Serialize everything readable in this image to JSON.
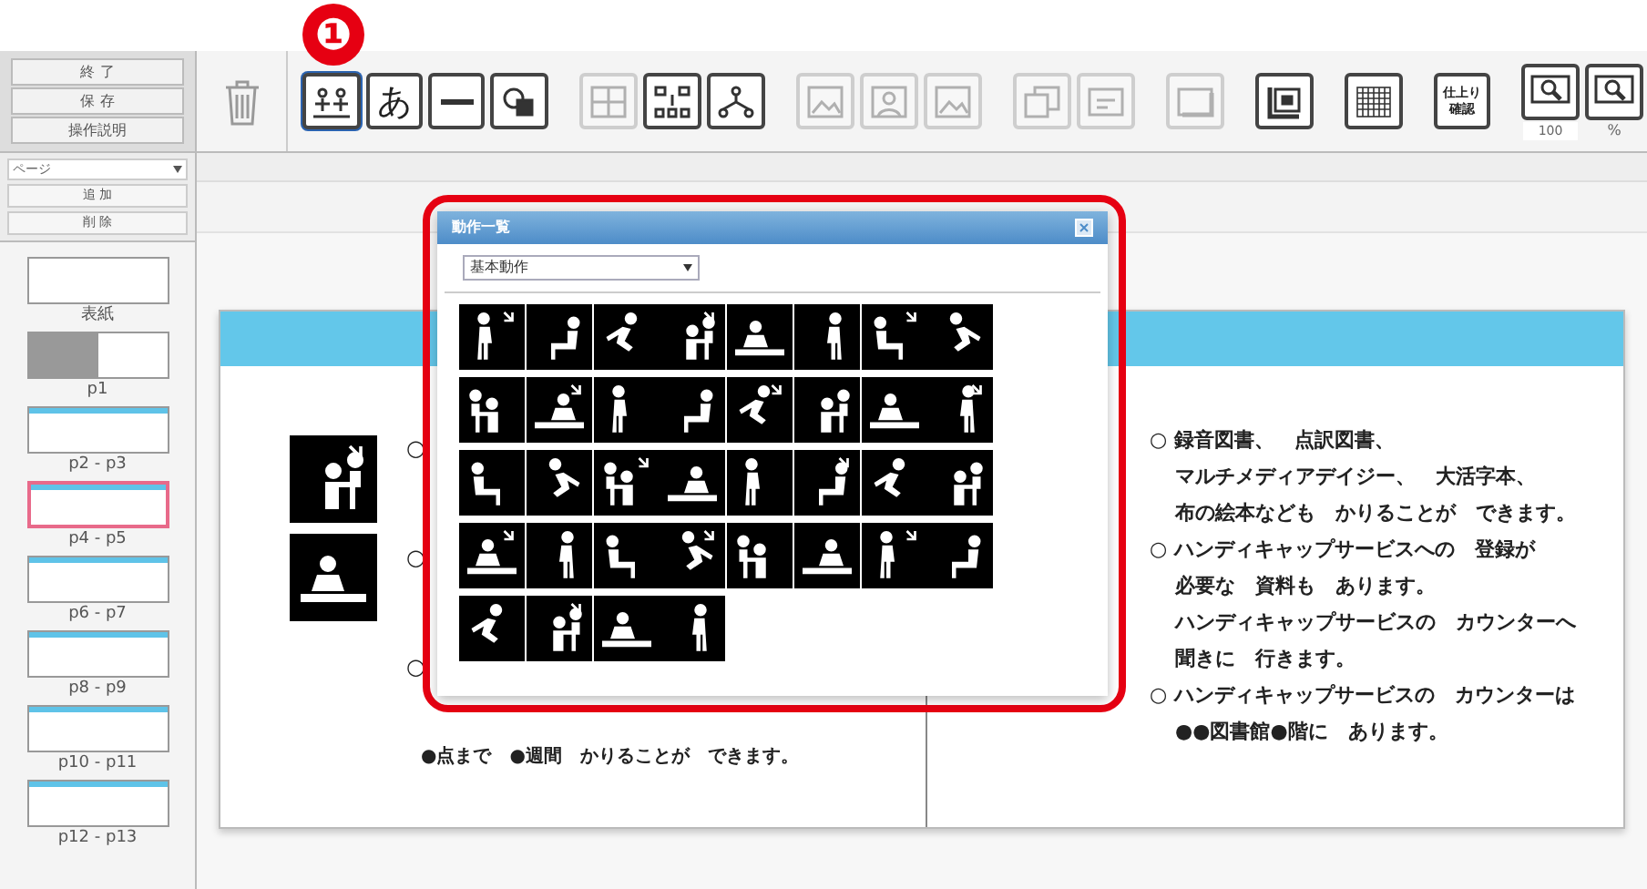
{
  "badge": "❶",
  "file_buttons": [
    "終 了",
    "保 存",
    "操作説明"
  ],
  "toolbar": [
    {
      "kind": "pictogram",
      "selected": true,
      "disabled": false
    },
    {
      "kind": "text",
      "label": "あ",
      "selected": false,
      "disabled": false
    },
    {
      "kind": "line",
      "selected": false,
      "disabled": false
    },
    {
      "kind": "shapes",
      "selected": false,
      "disabled": false
    },
    {
      "kind": "layout",
      "selected": false,
      "disabled": true
    },
    {
      "kind": "flow",
      "selected": false,
      "disabled": false
    },
    {
      "kind": "tree",
      "selected": false,
      "disabled": false
    },
    {
      "kind": "image",
      "selected": false,
      "disabled": true
    },
    {
      "kind": "person",
      "selected": false,
      "disabled": true
    },
    {
      "kind": "image",
      "selected": false,
      "disabled": true
    },
    {
      "kind": "copy",
      "selected": false,
      "disabled": true
    },
    {
      "kind": "paste",
      "selected": false,
      "disabled": true
    },
    {
      "kind": "frame",
      "selected": false,
      "disabled": true
    },
    {
      "kind": "book",
      "selected": false,
      "disabled": false
    },
    {
      "kind": "grid",
      "selected": false,
      "disabled": false
    },
    {
      "kind": "text",
      "label": "仕上り確認",
      "selected": false,
      "disabled": false
    },
    {
      "kind": "zoom",
      "selected": false,
      "disabled": false
    },
    {
      "kind": "zoom",
      "selected": false,
      "disabled": false
    }
  ],
  "zoom": {
    "value": "100",
    "unit": "%"
  },
  "page_select": "ページ",
  "page_buttons": [
    "追 加",
    "削 除"
  ],
  "thumbnails": [
    {
      "label": "表紙",
      "selected": false
    },
    {
      "label": "p1",
      "selected": false
    },
    {
      "label": "p2 - p3",
      "selected": false
    },
    {
      "label": "p4 - p5",
      "selected": true
    },
    {
      "label": "p6 - p7",
      "selected": false
    },
    {
      "label": "p8 - p9",
      "selected": false
    },
    {
      "label": "p10 - p11",
      "selected": false
    },
    {
      "label": "p12 - p13",
      "selected": false
    }
  ],
  "dialog": {
    "title": "動作一覧",
    "category": "基本動作"
  },
  "left_page": {
    "bullets": [
      "○",
      "○",
      "○"
    ],
    "last_line": "●点まで　●週間　かりることが　できます。"
  },
  "right_page": {
    "lines": [
      {
        "text": "○ 録音図書、　点訳図書、",
        "indent": false
      },
      {
        "text": "マルチメディアデイジー、　大活字本、",
        "indent": true
      },
      {
        "text": "布の絵本なども　かりることが　できます。",
        "indent": true
      },
      {
        "text": "○ ハンディキャップサービスへの　登録が",
        "indent": false
      },
      {
        "text": "必要な　資料も　あります。",
        "indent": true
      },
      {
        "text": "ハンディキャップサービスの　カウンターへ",
        "indent": true
      },
      {
        "text": "聞きに　行きます。",
        "indent": true
      },
      {
        "text": "○ ハンディキャップサービスの　カウンターは",
        "indent": false
      },
      {
        "text": "●●図書館●階に　あります。",
        "indent": true
      }
    ]
  }
}
